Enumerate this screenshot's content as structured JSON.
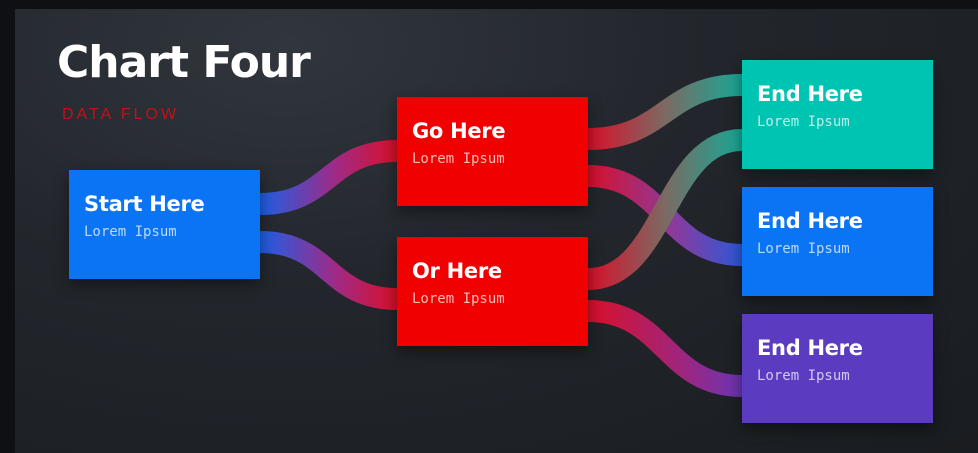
{
  "diagram": {
    "title": "Chart Four",
    "subtitle": "DATA FLOW",
    "nodes": {
      "start": {
        "title": "Start Here",
        "subtitle": "Lorem Ipsum",
        "color": "#0a74f5"
      },
      "go": {
        "title": "Go Here",
        "subtitle": "Lorem Ipsum",
        "color": "#f10000"
      },
      "or": {
        "title": "Or Here",
        "subtitle": "Lorem Ipsum",
        "color": "#f10000"
      },
      "end1": {
        "title": "End Here",
        "subtitle": "Lorem Ipsum",
        "color": "#00c4b2"
      },
      "end2": {
        "title": "End Here",
        "subtitle": "Lorem Ipsum",
        "color": "#0a74f5"
      },
      "end3": {
        "title": "End Here",
        "subtitle": "Lorem Ipsum",
        "color": "#5b3cc0"
      }
    },
    "connections": [
      {
        "from": "start",
        "to": "go"
      },
      {
        "from": "start",
        "to": "or"
      },
      {
        "from": "go",
        "to": "end1"
      },
      {
        "from": "go",
        "to": "end2"
      },
      {
        "from": "or",
        "to": "end1"
      },
      {
        "from": "or",
        "to": "end3"
      }
    ]
  }
}
